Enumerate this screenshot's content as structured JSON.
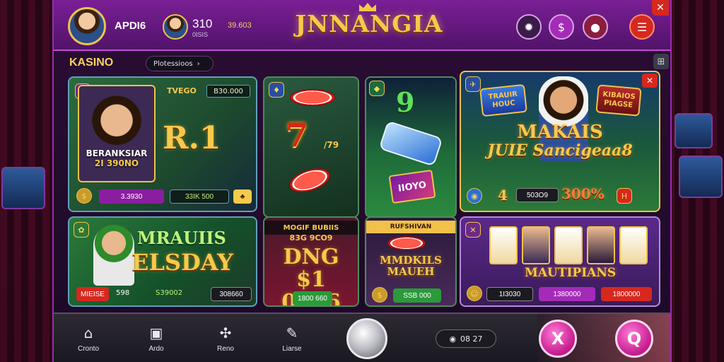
{
  "header": {
    "player_name": "APDI6",
    "player2_value": "310",
    "player2_sub": "0ISIS",
    "coins": "39.603",
    "logo": "JNNANGIA",
    "close_label": "✕"
  },
  "section": {
    "title": "KASINO",
    "filter_label": "Plotessioos"
  },
  "cards": {
    "c1": {
      "tag1": "TVEGO",
      "tag2": "B30.000",
      "name_line1": "BERANKSIAR",
      "name_line2": "2I 390NO",
      "big": "R.1",
      "pill1": "3.3930",
      "pill2": "33IK 500"
    },
    "c2": {
      "seven": "7",
      "seven_sub": "/79",
      "number_label": "7"
    },
    "c3": {
      "top": "9",
      "tile_text": "IIOYO"
    },
    "c4": {
      "badge_left": "TRAUIR HOUC",
      "badge_right": "KIBAIOS PIAGSE",
      "title_line1": "MAKAIS",
      "title_line2": "JUIE Sancigeaa8",
      "stat1": "4",
      "stat2": "503O9",
      "stat3": "300%",
      "close_label": "✕"
    },
    "c5": {
      "title1": "MRAUIIS",
      "title2": "ELSDAY",
      "pill1": "MIEISE",
      "pill2": "598",
      "pill3": "S39002",
      "pill4": "308660"
    },
    "c6": {
      "head": "MOGIF BUBIIS",
      "sub": "83G 9CO9",
      "amount_line1": "DNG",
      "amount_line2": "$1 0306",
      "footer": "1800 660"
    },
    "c7": {
      "head": "RUFSHIVAN",
      "title_line1": "MMDKILS",
      "title_line2": "MAUEH",
      "footer": "SSB 000"
    },
    "c8": {
      "label": "MAUTIPIANS",
      "pill1": "1I3030",
      "pill2": "1380000",
      "pill3": "1800000"
    }
  },
  "bottom_nav": {
    "items": [
      {
        "label": "Cronto",
        "icon": "home-icon"
      },
      {
        "label": "Ardo",
        "icon": "trophy-icon"
      },
      {
        "label": "Reno",
        "icon": "gift-icon"
      },
      {
        "label": "Liarse",
        "icon": "chat-icon"
      }
    ],
    "coin_balance": "08 27",
    "action_left": "X",
    "action_right": "Q"
  }
}
